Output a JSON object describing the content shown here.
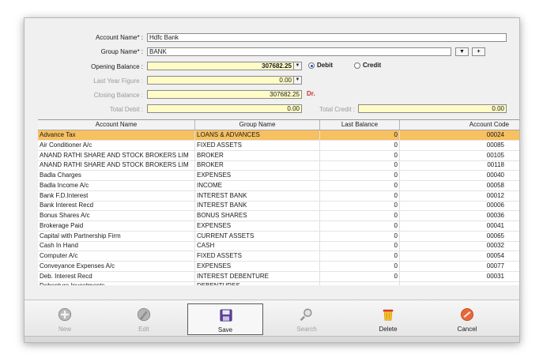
{
  "form": {
    "account_name_label": "Account Name* :",
    "account_name_value": "Hdfc Bank",
    "group_name_label": "Group Name* :",
    "group_name_value": "BANK",
    "group_dropdown_glyph": "▼",
    "group_add_glyph": "+",
    "opening_balance_label": "Opening Balance :",
    "opening_balance_value": "307682.25",
    "debit_label": "Debit",
    "credit_label": "Credit",
    "last_year_label": "Last Year Figure :",
    "last_year_value": "0.00",
    "closing_balance_label": "Closing Balance :",
    "closing_balance_value": "307682.25",
    "closing_suffix": "Dr.",
    "total_debit_label": "Total Debit :",
    "total_debit_value": "0.00",
    "total_credit_label": "Total Credit :",
    "total_credit_value": "0.00"
  },
  "grid": {
    "columns": [
      "Account Name",
      "Group Name",
      "Last Balance",
      "Account Code"
    ],
    "rows": [
      {
        "account": "Advance Tax",
        "group": "LOANS & ADVANCES",
        "balance": "0",
        "code": "00024"
      },
      {
        "account": "Air Conditioner A/c",
        "group": "FIXED ASSETS",
        "balance": "0",
        "code": "00085"
      },
      {
        "account": "ANAND RATHI SHARE AND STOCK BROKERS LIM",
        "group": "BROKER",
        "balance": "0",
        "code": "00105"
      },
      {
        "account": "ANAND RATHI SHARE AND STOCK BROKERS LIM",
        "group": "BROKER",
        "balance": "0",
        "code": "00118"
      },
      {
        "account": "Badla Charges",
        "group": "EXPENSES",
        "balance": "0",
        "code": "00040"
      },
      {
        "account": "Badla Income A/c",
        "group": "INCOME",
        "balance": "0",
        "code": "00058"
      },
      {
        "account": "Bank F.D.Interest",
        "group": "INTEREST BANK",
        "balance": "0",
        "code": "00012"
      },
      {
        "account": "Bank Interest Recd",
        "group": "INTEREST BANK",
        "balance": "0",
        "code": "00006"
      },
      {
        "account": "Bonus Shares A/c",
        "group": "BONUS SHARES",
        "balance": "0",
        "code": "00036"
      },
      {
        "account": "Brokerage Paid",
        "group": "EXPENSES",
        "balance": "0",
        "code": "00041"
      },
      {
        "account": "Capital with Partnership Firm",
        "group": "CURRENT ASSETS",
        "balance": "0",
        "code": "00065"
      },
      {
        "account": "Cash In Hand",
        "group": "CASH",
        "balance": "0",
        "code": "00032"
      },
      {
        "account": "Computer A/c",
        "group": "FIXED ASSETS",
        "balance": "0",
        "code": "00054"
      },
      {
        "account": "Conveyance Expenses A/c",
        "group": "EXPENSES",
        "balance": "0",
        "code": "00077"
      },
      {
        "account": "Deb. Interest Recd",
        "group": "INTEREST DEBENTURE",
        "balance": "0",
        "code": "00031"
      },
      {
        "account": "Debenture Investments",
        "group": "DEBENTURES",
        "balance": "",
        "code": ""
      }
    ]
  },
  "toolbar": {
    "new": "New",
    "edit": "Edit",
    "save": "Save",
    "search": "Search",
    "delete": "Delete",
    "cancel": "Cancel"
  },
  "icons": {
    "new": "plus-circle-icon",
    "edit": "pencil-circle-icon",
    "save": "floppy-disk-icon",
    "search": "magnifier-icon",
    "delete": "trash-bin-icon",
    "cancel": "cancel-circle-icon"
  },
  "colors": {
    "selected_row": "#f7c060",
    "yellow_field": "#fffcc8",
    "closing_suffix": "#c0392b"
  }
}
